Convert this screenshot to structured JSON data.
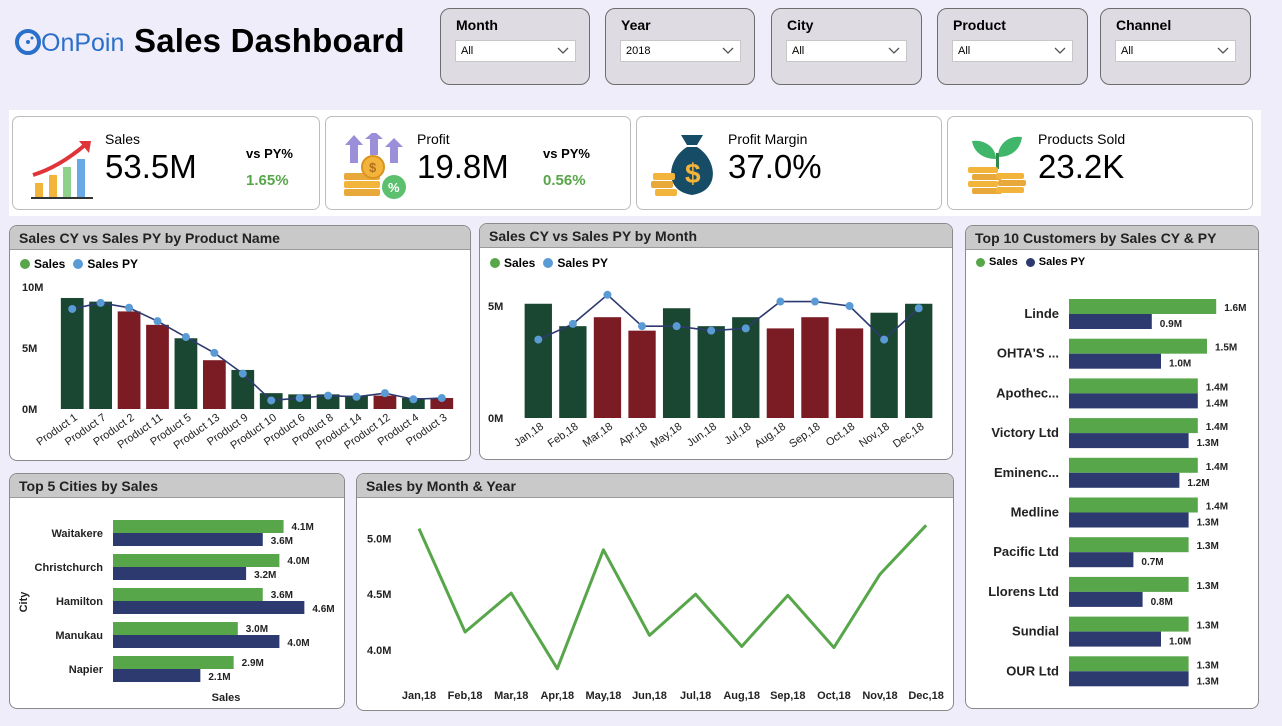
{
  "header": {
    "logo_text": "OnPoint",
    "title": "Sales Dashboard"
  },
  "filters": [
    {
      "label": "Month",
      "value": "All"
    },
    {
      "label": "Year",
      "value": "2018"
    },
    {
      "label": "City",
      "value": "All"
    },
    {
      "label": "Product",
      "value": "All"
    },
    {
      "label": "Channel",
      "value": "All"
    }
  ],
  "kpis": {
    "sales": {
      "label": "Sales",
      "value": "53.5M",
      "vs_label": "vs PY%",
      "vs_value": "1.65%",
      "icon": "growth-chart-icon"
    },
    "profit": {
      "label": "Profit",
      "value": "19.8M",
      "vs_label": "vs PY%",
      "vs_value": "0.56%",
      "icon": "profit-coins-icon"
    },
    "margin": {
      "label": "Profit Margin",
      "value": "37.0%",
      "icon": "money-bag-icon"
    },
    "sold": {
      "label": "Products Sold",
      "value": "23.2K",
      "icon": "plant-coins-icon"
    }
  },
  "colors": {
    "sales_green": "#1a4731",
    "sales_red": "#7b1c24",
    "sales_py": "#5b9bd5",
    "line_navy": "#2d3a70",
    "bar_green": "#57a64a",
    "bar_navy": "#2d3a70",
    "header_bg": "#c9c9c9"
  },
  "chart_data": [
    {
      "id": "product",
      "title": "Sales CY vs Sales PY by Product Name",
      "type": "bar",
      "legend": [
        "Sales",
        "Sales PY"
      ],
      "categories": [
        "Product 1",
        "Product 7",
        "Product 2",
        "Product 11",
        "Product 5",
        "Product 13",
        "Product 9",
        "Product 10",
        "Product 6",
        "Product 8",
        "Product 14",
        "Product 12",
        "Product 4",
        "Product 3"
      ],
      "sales": [
        9.1,
        8.8,
        8.0,
        6.9,
        5.8,
        4.0,
        3.2,
        1.3,
        1.2,
        1.2,
        1.1,
        1.1,
        0.9,
        0.9
      ],
      "sales_py": [
        8.2,
        8.7,
        8.3,
        7.2,
        5.9,
        4.6,
        2.9,
        0.7,
        0.9,
        1.1,
        1.0,
        1.3,
        0.8,
        0.9
      ],
      "below_py": [
        false,
        false,
        true,
        true,
        false,
        true,
        false,
        false,
        false,
        false,
        false,
        true,
        false,
        true
      ],
      "yticks": [
        "10M",
        "5M",
        "0M"
      ],
      "ylim": [
        0,
        10
      ]
    },
    {
      "id": "month",
      "title": "Sales CY vs Sales PY by Month",
      "type": "bar",
      "legend": [
        "Sales",
        "Sales PY"
      ],
      "categories": [
        "Jan,18",
        "Feb,18",
        "Mar,18",
        "Apr,18",
        "May,18",
        "Jun,18",
        "Jul,18",
        "Aug,18",
        "Sep,18",
        "Oct,18",
        "Nov,18",
        "Dec,18"
      ],
      "sales": [
        5.1,
        4.1,
        4.5,
        3.9,
        4.9,
        4.1,
        4.5,
        4.0,
        4.5,
        4.0,
        4.7,
        5.1
      ],
      "sales_py": [
        3.5,
        4.2,
        5.5,
        4.1,
        4.1,
        3.9,
        4.0,
        5.2,
        5.2,
        5.0,
        3.5,
        4.9
      ],
      "below_py": [
        false,
        false,
        true,
        true,
        false,
        false,
        false,
        true,
        true,
        true,
        false,
        false
      ],
      "yticks": [
        "5M",
        "0M"
      ],
      "ylim": [
        0,
        5
      ]
    },
    {
      "id": "customers",
      "title": "Top 10 Customers by Sales CY & PY",
      "type": "bar",
      "orientation": "horizontal",
      "legend": [
        "Sales",
        "Sales PY"
      ],
      "categories": [
        "Linde",
        "OHTA'S ...",
        "Apothec...",
        "Victory Ltd",
        "Eminenc...",
        "Medline",
        "Pacific Ltd",
        "Llorens Ltd",
        "Sundial",
        "OUR Ltd"
      ],
      "series": [
        {
          "name": "Sales",
          "values": [
            1.6,
            1.5,
            1.4,
            1.4,
            1.4,
            1.4,
            1.3,
            1.3,
            1.3,
            1.3
          ],
          "labels": [
            "1.6M",
            "1.5M",
            "1.4M",
            "1.4M",
            "1.4M",
            "1.4M",
            "1.3M",
            "1.3M",
            "1.3M",
            "1.3M"
          ]
        },
        {
          "name": "Sales PY",
          "values": [
            0.9,
            1.0,
            1.4,
            1.3,
            1.2,
            1.3,
            0.7,
            0.8,
            1.0,
            1.3
          ],
          "labels": [
            "0.9M",
            "1.0M",
            "1.4M",
            "1.3M",
            "1.2M",
            "1.3M",
            "0.7M",
            "0.8M",
            "1.0M",
            "1.3M"
          ]
        }
      ]
    },
    {
      "id": "cities",
      "title": "Top 5 Cities by Sales",
      "type": "bar",
      "orientation": "horizontal",
      "xlabel": "Sales",
      "ylabel": "City",
      "categories": [
        "Waitakere",
        "Christchurch",
        "Hamilton",
        "Manukau",
        "Napier"
      ],
      "series": [
        {
          "name": "Sales",
          "values": [
            4.1,
            4.0,
            3.6,
            3.0,
            2.9
          ],
          "labels": [
            "4.1M",
            "4.0M",
            "3.6M",
            "3.0M",
            "2.9M"
          ]
        },
        {
          "name": "Sales PY",
          "values": [
            3.6,
            3.2,
            4.6,
            4.0,
            2.1
          ],
          "labels": [
            "3.6M",
            "3.2M",
            "4.6M",
            "4.0M",
            "2.1M"
          ]
        }
      ]
    },
    {
      "id": "trend",
      "title": "Sales by Month & Year",
      "type": "line",
      "categories": [
        "Jan,18",
        "Feb,18",
        "Mar,18",
        "Apr,18",
        "May,18",
        "Jun,18",
        "Jul,18",
        "Aug,18",
        "Sep,18",
        "Oct,18",
        "Nov,18",
        "Dec,18"
      ],
      "values": [
        5.09,
        4.16,
        4.51,
        3.83,
        4.9,
        4.13,
        4.5,
        4.03,
        4.49,
        4.02,
        4.68,
        5.12
      ],
      "yticks": [
        {
          "v": 5.0,
          "label": "5.0M"
        },
        {
          "v": 4.5,
          "label": "4.5M"
        },
        {
          "v": 4.0,
          "label": "4.0M"
        }
      ],
      "ylim": [
        3.8,
        5.15
      ]
    }
  ]
}
